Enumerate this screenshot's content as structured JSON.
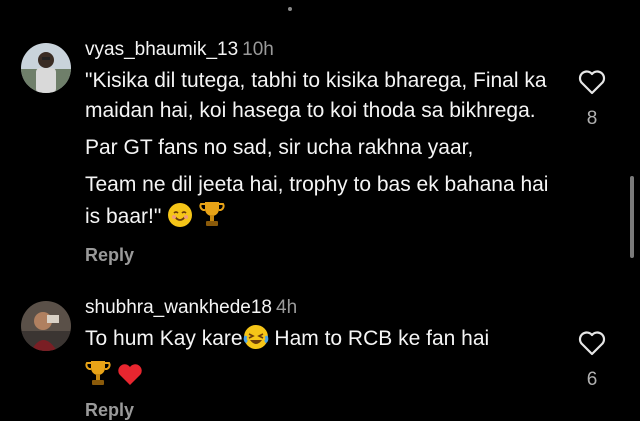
{
  "comments": [
    {
      "username": "vyas_bhaumik_13",
      "time": "10h",
      "paragraphs": [
        "\"Kisika dil tutega, tabhi to kisika bharega, Final ka maidan hai, koi hasega to koi thoda sa bikhrega.",
        "Par GT fans no sad, sir ucha rakhna yaar,",
        "Team ne dil jeeta hai, trophy to bas ek bahana hai is baar!\""
      ],
      "emojis": [
        "smiling-face-emoji",
        "trophy-emoji"
      ],
      "reply_label": "Reply",
      "like_count": "8",
      "avatar_icon": "user-avatar-photo"
    },
    {
      "username": "shubhra_wankhede18",
      "time": "4h",
      "text_before_emoji": "To hum Kay kare",
      "text_after_emoji": " Ham to RCB ke fan hai",
      "emojis": [
        "laughing-tears-emoji",
        "trophy-emoji",
        "red-heart-emoji"
      ],
      "reply_label": "Reply",
      "like_count": "6",
      "avatar_icon": "user-avatar-photo"
    }
  ],
  "icons": {
    "like": "heart-outline-icon"
  },
  "colors": {
    "background": "#000000",
    "text": "#f5f5f5",
    "muted": "#9a9a9a"
  }
}
